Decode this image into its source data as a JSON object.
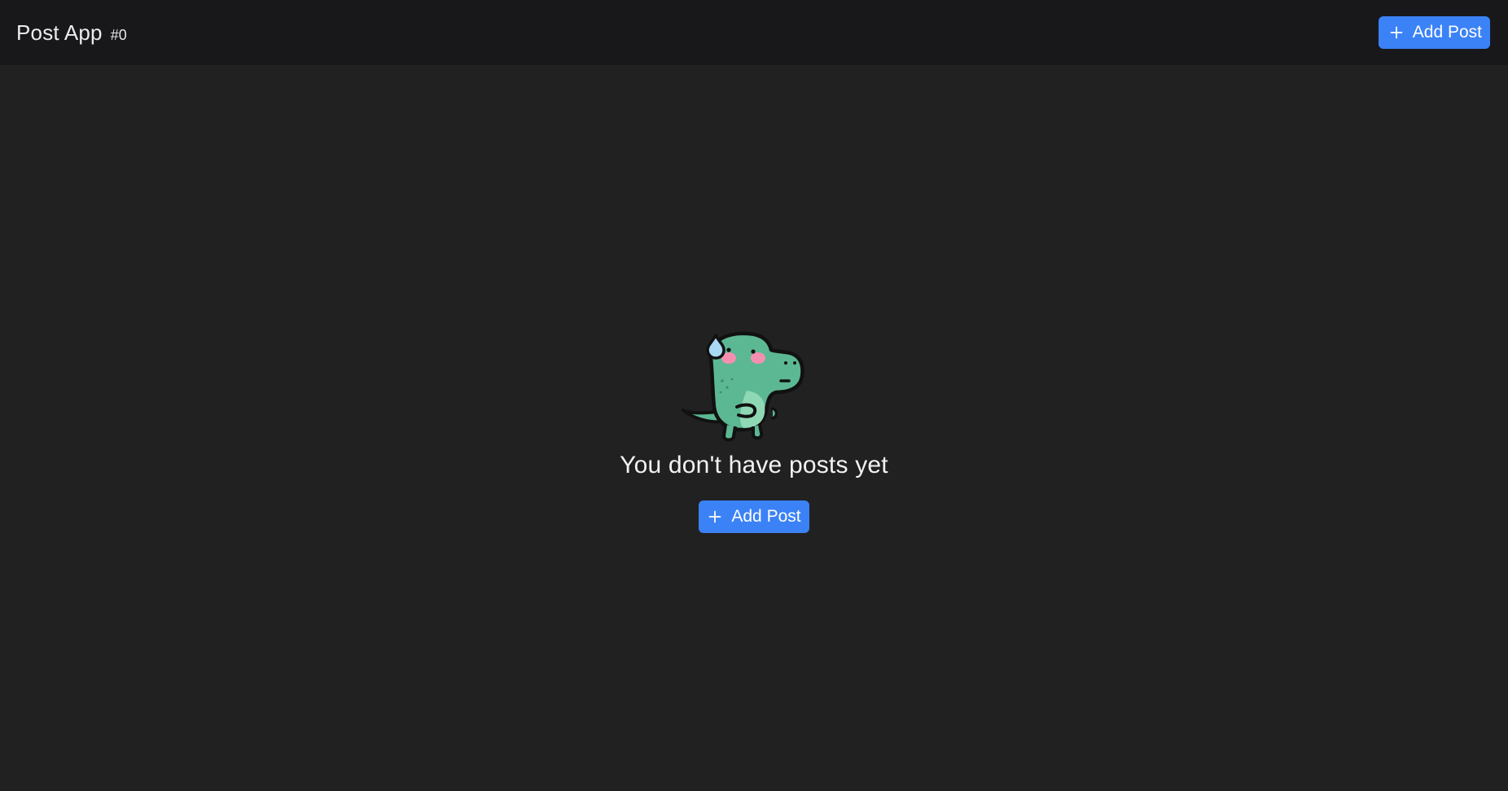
{
  "header": {
    "title": "Post App",
    "count": "#0",
    "add_button_label": "Add Post"
  },
  "empty_state": {
    "message": "You don't have posts yet",
    "add_button_label": "Add Post",
    "illustration": "sweating-dinosaur-icon"
  },
  "icons": {
    "add": "plus-icon"
  },
  "colors": {
    "accent": "#3b82f6",
    "background": "#212121",
    "header_background": "#18181b",
    "mascot_green": "#5cb892"
  }
}
